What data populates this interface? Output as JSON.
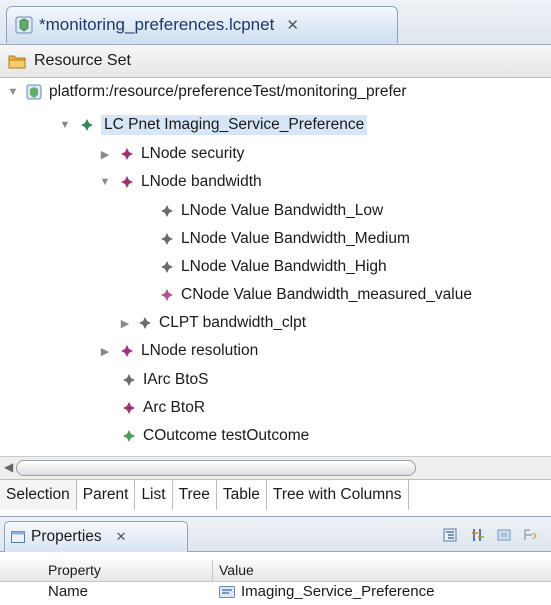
{
  "editor": {
    "tab_title": "*monitoring_preferences.lcpnet",
    "tab_close": "✕"
  },
  "resource_set": {
    "title": "Resource Set"
  },
  "tree": {
    "platform_label": "platform:/resource/preferenceTest/monitoring_prefer",
    "root_label": "LC Pnet Imaging_Service_Preference",
    "security": "LNode security",
    "bandwidth": "LNode bandwidth",
    "bw_low": "LNode Value Bandwidth_Low",
    "bw_medium": "LNode Value Bandwidth_Medium",
    "bw_high": "LNode Value Bandwidth_High",
    "bw_measured": "CNode Value Bandwidth_measured_value",
    "bw_clpt": "CLPT bandwidth_clpt",
    "resolution": "LNode resolution",
    "arc_btos": "IArc BtoS",
    "arc_btor": "Arc BtoR",
    "outcome": "COutcome testOutcome"
  },
  "bottom_tabs": [
    "Selection",
    "Parent",
    "List",
    "Tree",
    "Table",
    "Tree with Columns"
  ],
  "properties": {
    "title": "Properties",
    "close": "✕",
    "col_property": "Property",
    "col_value": "Value",
    "row_name": "Name",
    "row_value": "Imaging_Service_Preference"
  },
  "colors": {
    "lnode": "#a0307a",
    "value": "#6b6b6b",
    "lcpnet": "#2e8b57",
    "selection": "#d7e6f7"
  }
}
